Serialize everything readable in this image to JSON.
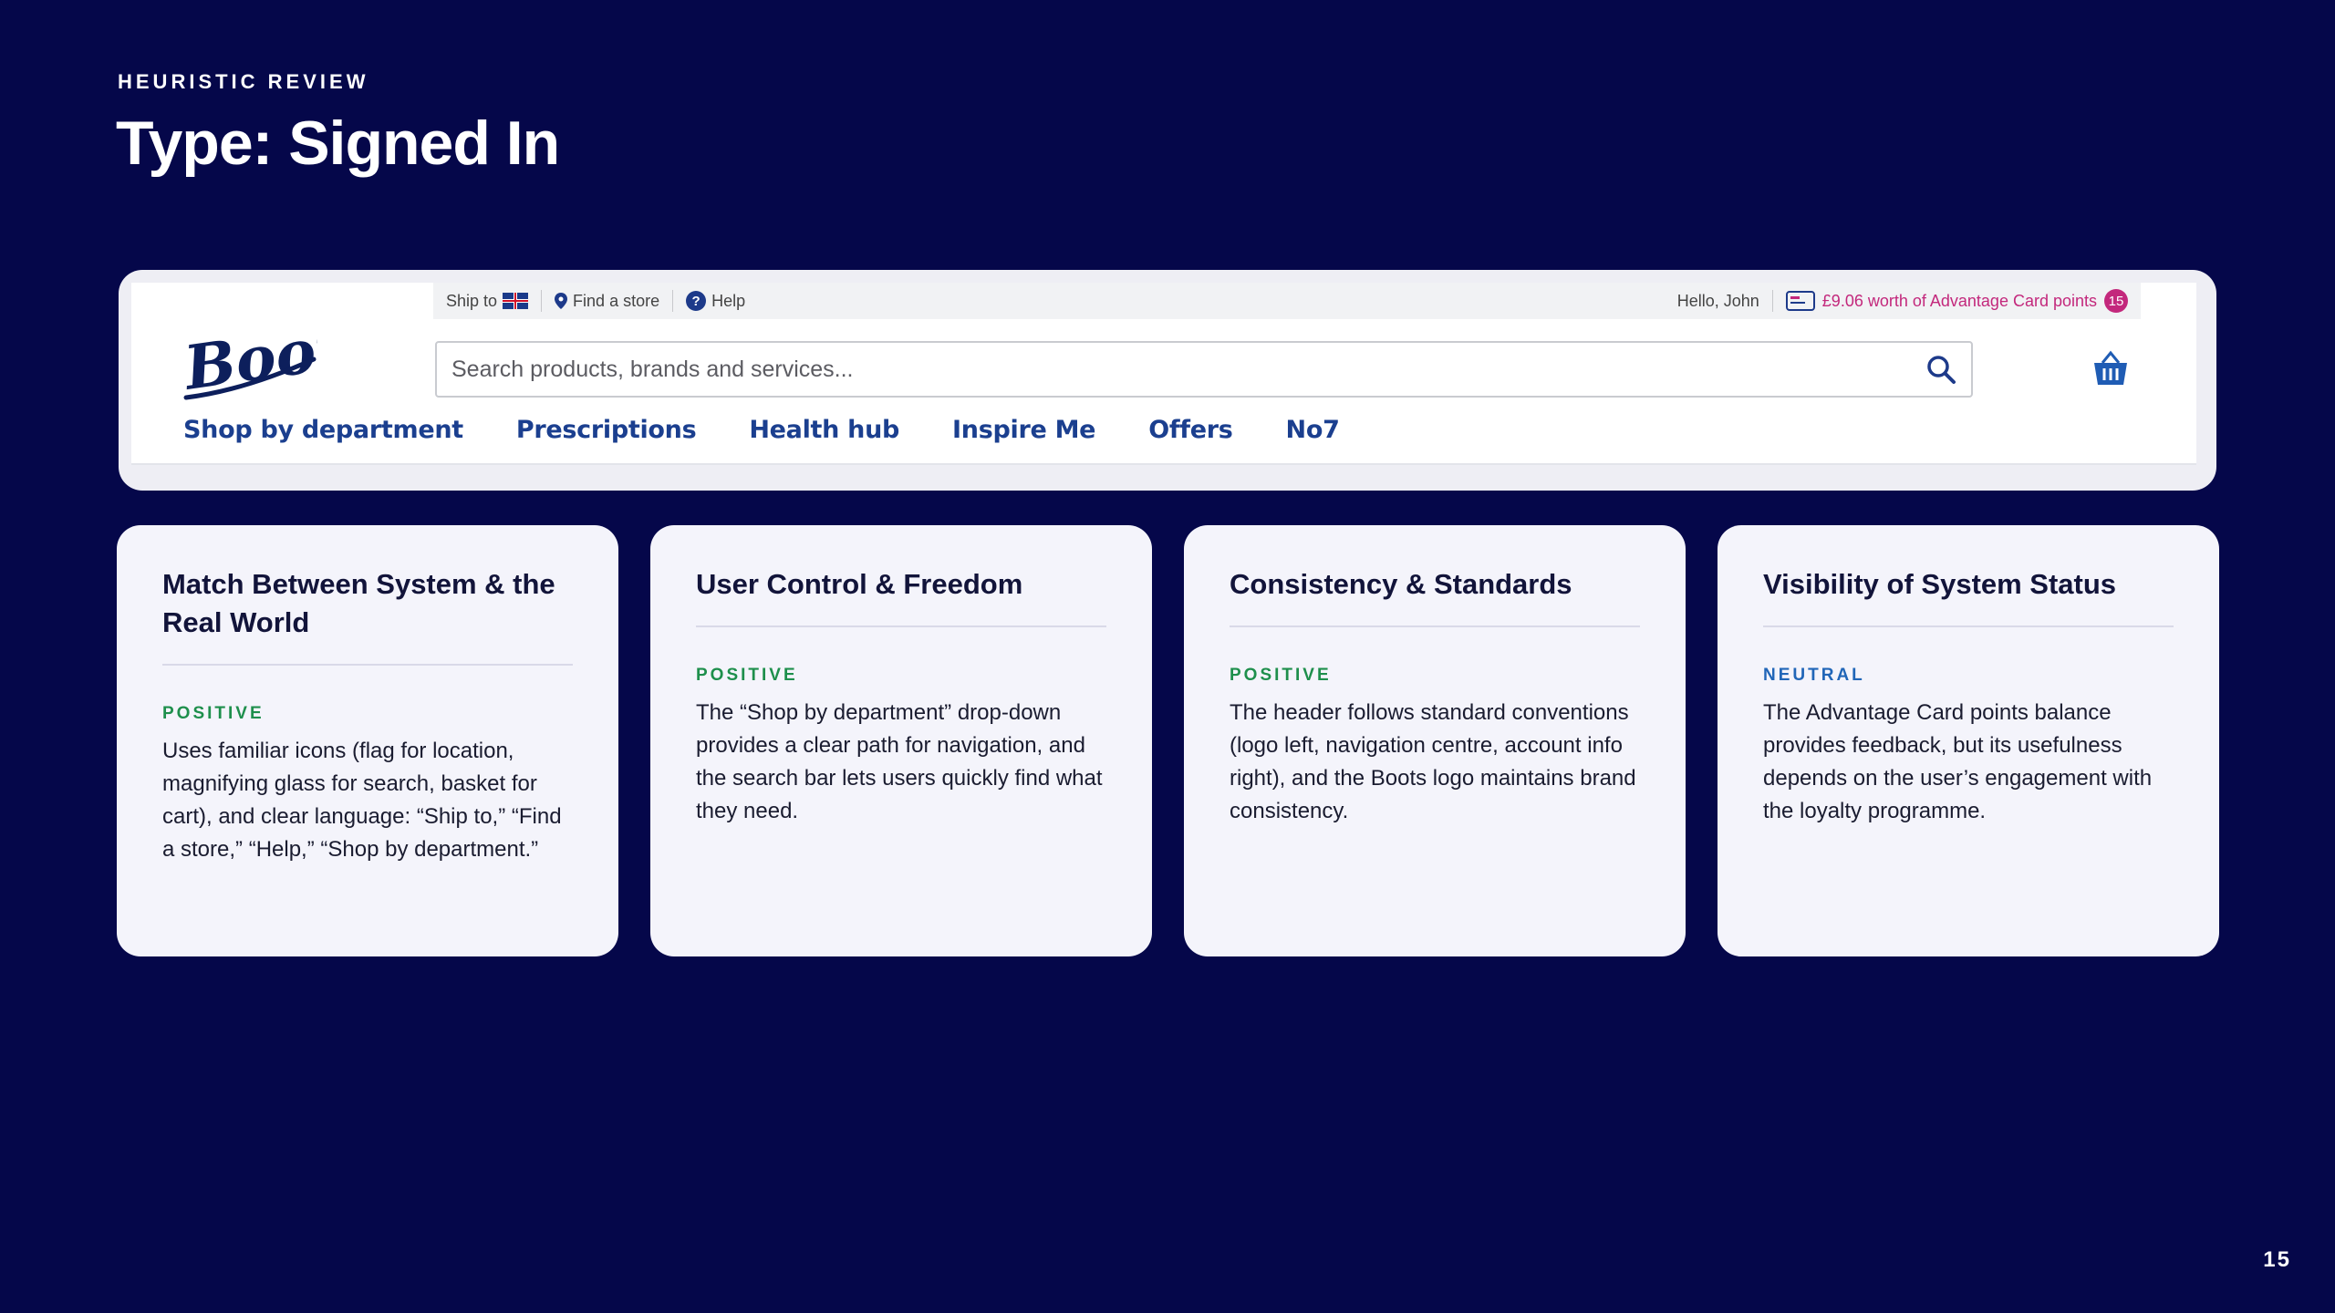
{
  "slide": {
    "eyebrow": "HEURISTIC REVIEW",
    "title": "Type: Signed In",
    "page_number": "15"
  },
  "screenshot": {
    "logo_text": "Boots",
    "utility_bar": {
      "ship_to": "Ship to",
      "find_store": "Find a store",
      "help": "Help",
      "greeting": "Hello, John",
      "points_text": "£9.06 worth of Advantage Card points",
      "points_badge": "15"
    },
    "search": {
      "placeholder": "Search products, brands and services..."
    },
    "nav": [
      "Shop by department",
      "Prescriptions",
      "Health hub",
      "Inspire Me",
      "Offers",
      "No7"
    ],
    "colors": {
      "brand_blue": "#1b3f8f",
      "points_pink": "#c3287c"
    }
  },
  "cards": [
    {
      "title": "Match Between System & the Real World",
      "tag": "POSITIVE",
      "text": "Uses familiar icons (flag for location, magnifying glass for search, basket for cart), and clear language: “Ship to,” “Find a store,” “Help,” “Shop by department.”"
    },
    {
      "title": "User Control & Freedom",
      "tag": "POSITIVE",
      "text": "The “Shop by department” drop-down provides a clear path for navigation, and the search bar lets users quickly find what they need."
    },
    {
      "title": "Consistency & Standards",
      "tag": "POSITIVE",
      "text": "The header follows standard conventions (logo left, navigation centre, account info right), and the Boots logo maintains brand consistency."
    },
    {
      "title": "Visibility of System Status",
      "tag": "NEUTRAL",
      "text": "The Advantage Card points balance provides feedback, but its usefulness depends on the user’s engagement with the loyalty programme."
    }
  ],
  "tag_colors": {
    "positive": "#1e8f4c",
    "neutral": "#2166b8"
  }
}
